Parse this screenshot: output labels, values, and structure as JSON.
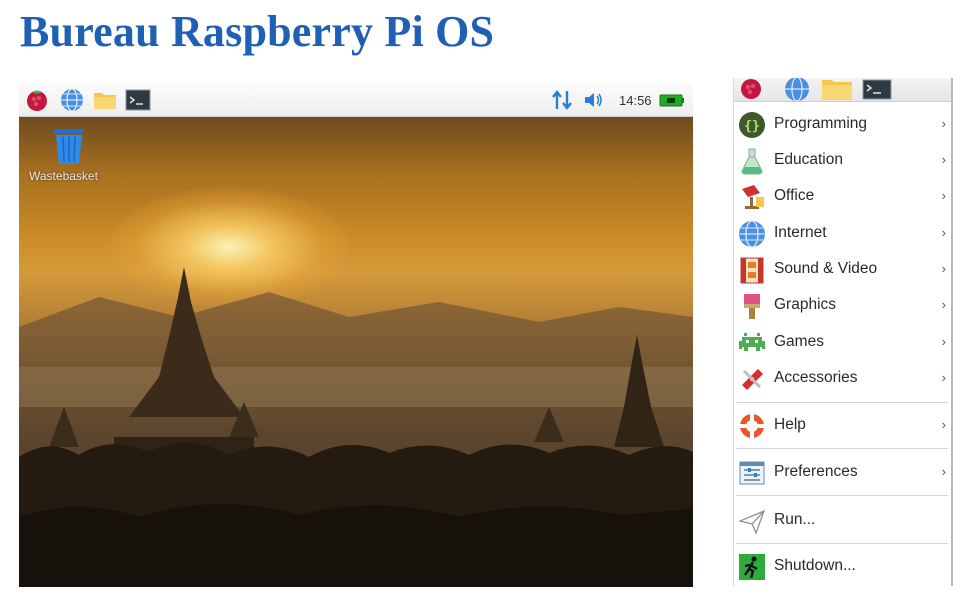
{
  "heading": "Bureau Raspberry Pi OS",
  "desktop": {
    "clock": "14:56",
    "wastebasket_label": "Wastebasket"
  },
  "menu": {
    "items": [
      {
        "label": "Programming",
        "icon": "programming-icon",
        "submenu": true
      },
      {
        "label": "Education",
        "icon": "education-icon",
        "submenu": true
      },
      {
        "label": "Office",
        "icon": "office-icon",
        "submenu": true
      },
      {
        "label": "Internet",
        "icon": "internet-icon",
        "submenu": true
      },
      {
        "label": "Sound & Video",
        "icon": "sound-video-icon",
        "submenu": true
      },
      {
        "label": "Graphics",
        "icon": "graphics-icon",
        "submenu": true
      },
      {
        "label": "Games",
        "icon": "games-icon",
        "submenu": true
      },
      {
        "label": "Accessories",
        "icon": "accessories-icon",
        "submenu": true
      },
      {
        "label": "Help",
        "icon": "help-icon",
        "submenu": true
      },
      {
        "label": "Preferences",
        "icon": "preferences-icon",
        "submenu": true
      },
      {
        "label": "Run...",
        "icon": "run-icon",
        "submenu": false
      },
      {
        "label": "Shutdown...",
        "icon": "shutdown-icon",
        "submenu": false
      }
    ],
    "chevron": "›"
  },
  "colors": {
    "heading": "#1f5fb4",
    "taskbar": "#f1f1f1",
    "battery": "#22aa22",
    "network_arrows": "#2a7fd4"
  }
}
